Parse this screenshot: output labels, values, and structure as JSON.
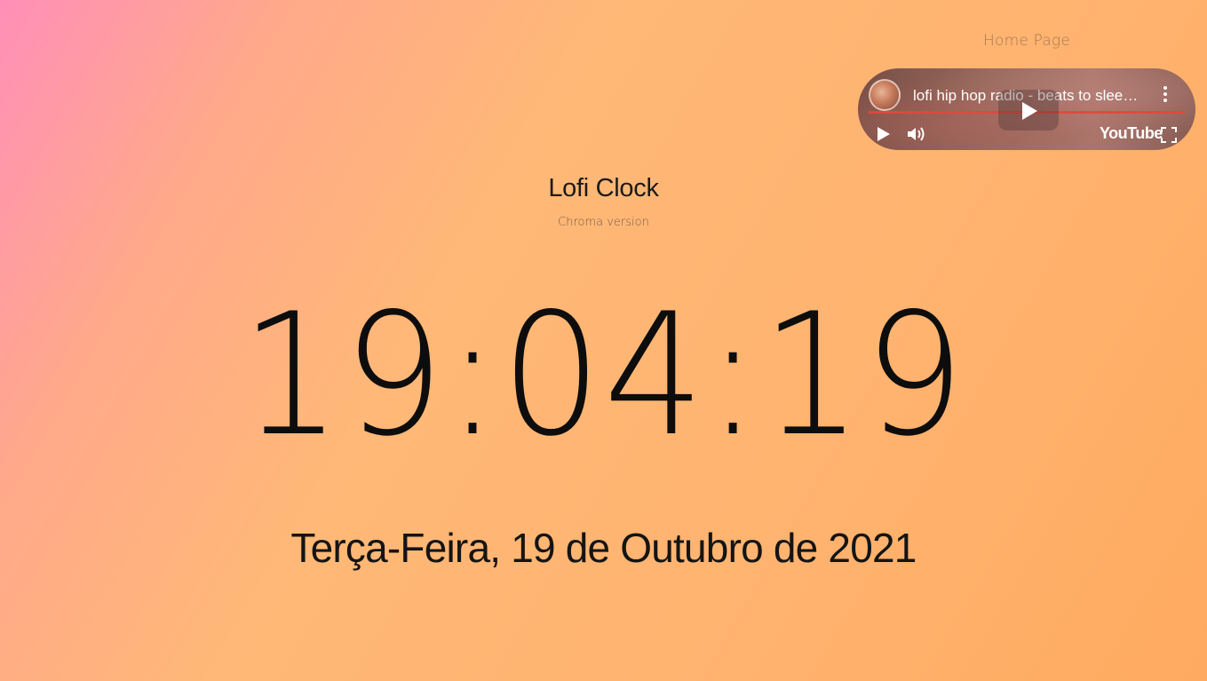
{
  "nav": {
    "home_link": "Home Page"
  },
  "player": {
    "video_title": "lofi hip hop radio - beats to sleep/chill to",
    "brand": "YouTube",
    "icons": {
      "channel": "channel-avatar-icon",
      "menu": "more-vertical-icon",
      "big_play": "play-icon",
      "play": "play-icon",
      "volume": "volume-icon",
      "fullscreen": "fullscreen-icon"
    },
    "progress_color": "#e6463c"
  },
  "header": {
    "title": "Lofi Clock",
    "subtitle": "Chroma version"
  },
  "clock": {
    "time": "19:04:19",
    "date": "Terça-Feira, 19 de Outubro de 2021"
  },
  "theme": {
    "gradient_start": "#ff8fb8",
    "gradient_end": "#ffaa60",
    "text_color": "#111111"
  }
}
